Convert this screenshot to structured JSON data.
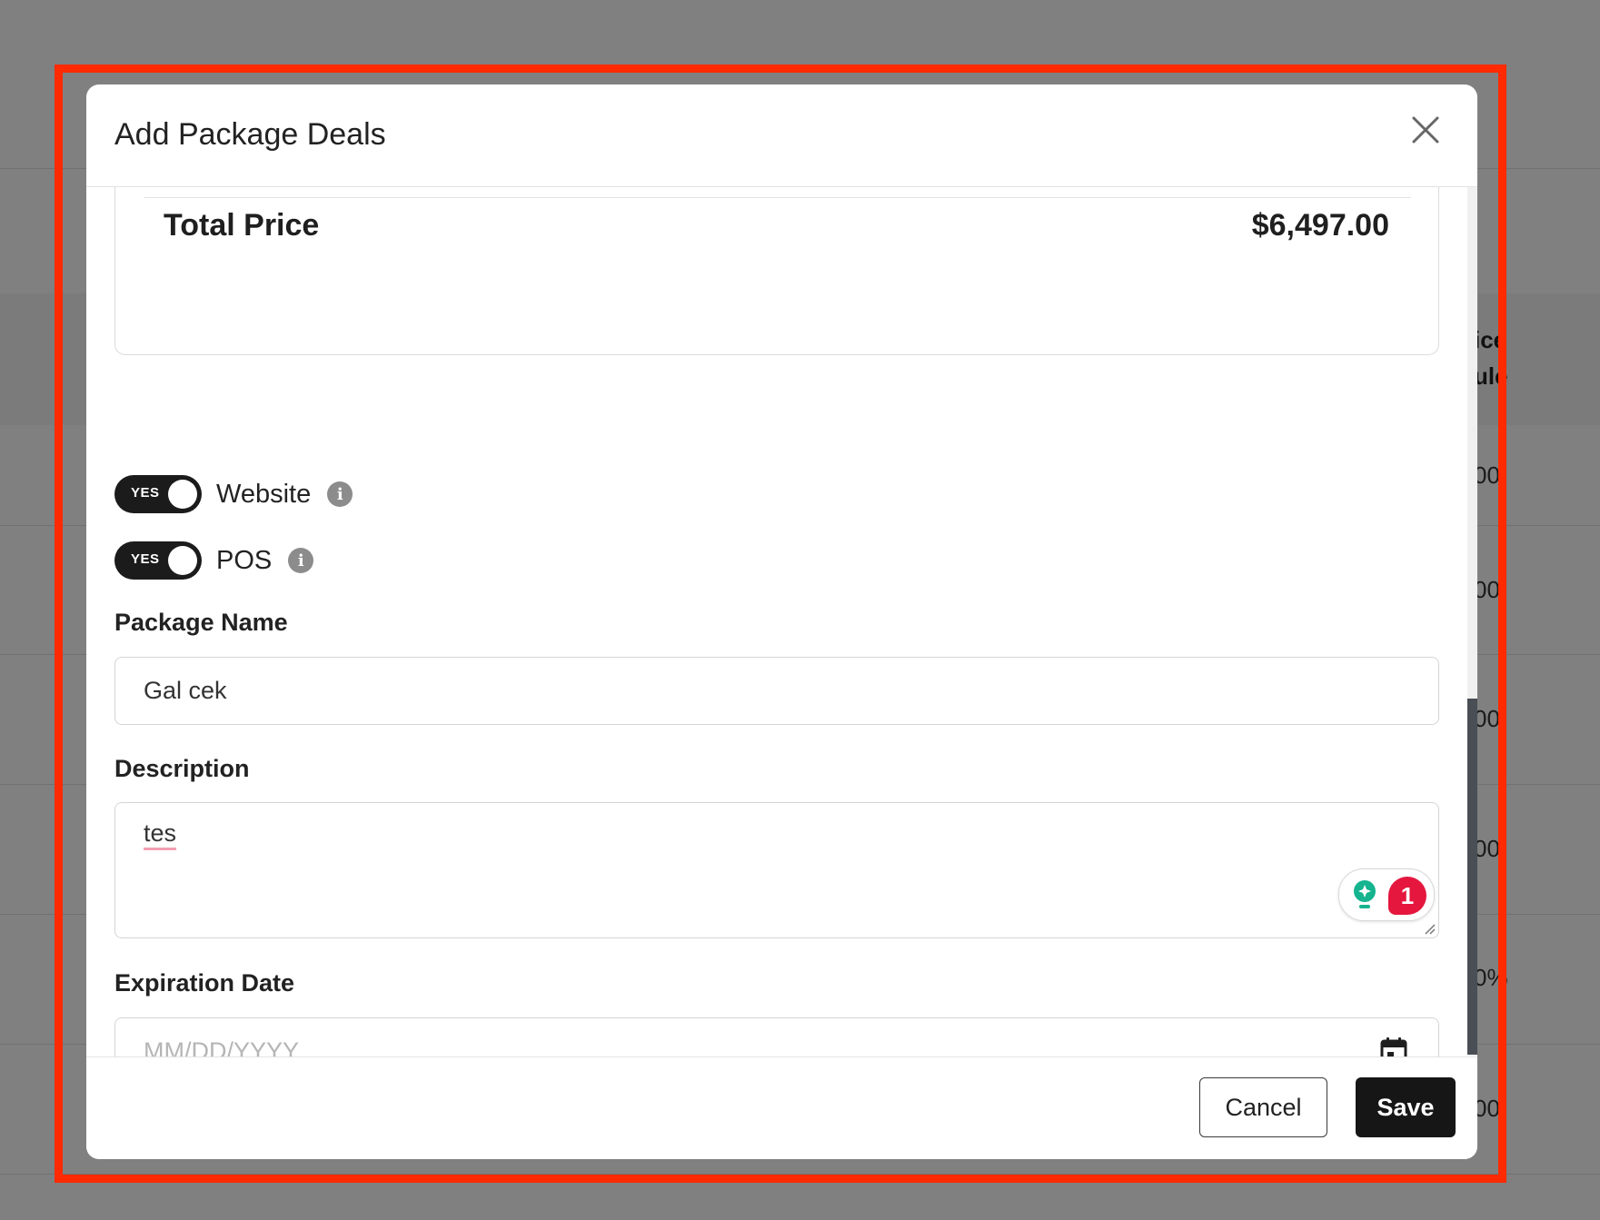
{
  "background_table": {
    "header_fragments": [
      "ice",
      "ule"
    ],
    "cell_fragments": [
      "00",
      "00",
      "00",
      "00",
      "0%",
      "00"
    ]
  },
  "modal": {
    "title": "Add Package Deals",
    "summary": {
      "total_label": "Total Price",
      "total_value": "$6,497.00"
    },
    "toggles": [
      {
        "state_text": "YES",
        "label": "Website",
        "enabled": true
      },
      {
        "state_text": "YES",
        "label": "POS",
        "enabled": true
      }
    ],
    "fields": {
      "package_name": {
        "label": "Package Name",
        "value": "Gal cek"
      },
      "description": {
        "label": "Description",
        "value": "tes",
        "issue_count": "1"
      },
      "expiration_date": {
        "label": "Expiration Date",
        "value": "",
        "placeholder": "MM/DD/YYYY"
      }
    },
    "footer": {
      "cancel_label": "Cancel",
      "save_label": "Save"
    }
  },
  "colors": {
    "annotation_frame": "#ff2a00",
    "toggle_on": "#1b1b1b",
    "save_button": "#161616",
    "grammarly_badge": "#e5173f",
    "grammarly_bulb": "#15b48f"
  },
  "icons": [
    "close-icon",
    "info-icon",
    "calendar-icon",
    "grammarly-bulb-icon",
    "resize-handle-icon"
  ]
}
